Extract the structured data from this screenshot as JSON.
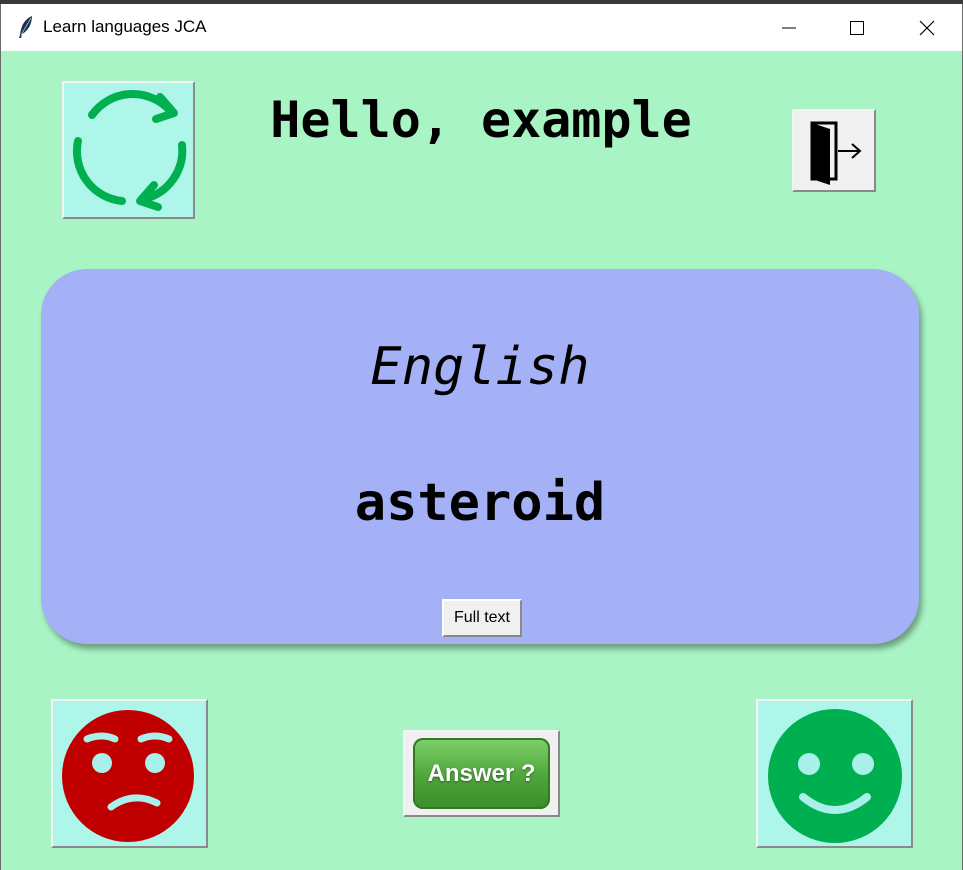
{
  "window": {
    "title": "Learn languages JCA",
    "icons": [
      "feather-app-icon",
      "minimize-icon",
      "maximize-icon",
      "close-icon"
    ]
  },
  "header": {
    "greeting": "Hello, example",
    "refresh_icon": "refresh-cycle-icon",
    "exit_icon": "exit-door-icon"
  },
  "card": {
    "language": "English",
    "word": "asteroid",
    "full_text_label": "Full text"
  },
  "footer": {
    "answer_label": "Answer ?",
    "sad_icon": "sad-face-icon",
    "happy_icon": "happy-face-icon"
  },
  "colors": {
    "background": "#a8f4c4",
    "card": "#a5b1f6",
    "icon_button_bg": "#aef5ea",
    "refresh_green": "#00b050",
    "sad_red": "#c00000",
    "happy_green": "#00b050"
  }
}
